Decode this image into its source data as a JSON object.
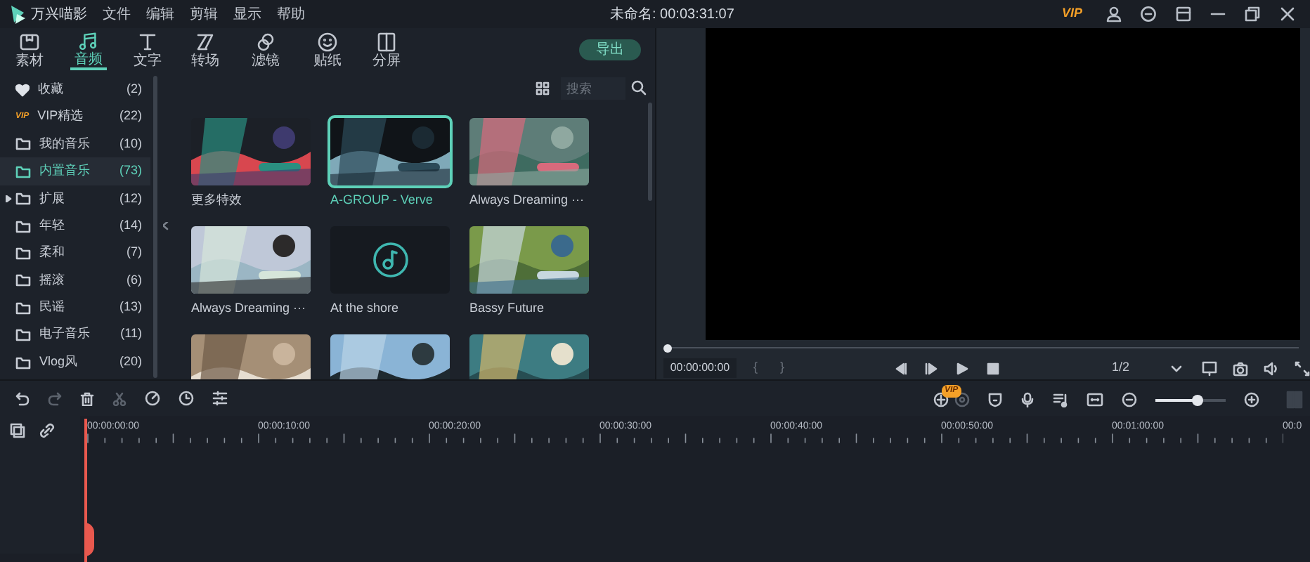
{
  "title_bar": {
    "app_name": "万兴喵影",
    "menu": [
      "文件",
      "编辑",
      "剪辑",
      "显示",
      "帮助"
    ],
    "project_title": "未命名: 00:03:31:07",
    "vip_badge": "VIP"
  },
  "media_tabs": [
    {
      "label": "素材",
      "selected": false
    },
    {
      "label": "音频",
      "selected": true
    },
    {
      "label": "文字",
      "selected": false
    },
    {
      "label": "转场",
      "selected": false
    },
    {
      "label": "滤镜",
      "selected": false
    },
    {
      "label": "贴纸",
      "selected": false
    },
    {
      "label": "分屏",
      "selected": false
    }
  ],
  "export_button": "导出",
  "library": [
    {
      "kind": "favorite",
      "label": "收藏",
      "count": "(2)",
      "selected": false
    },
    {
      "kind": "vip",
      "badge": "VIP",
      "label": "VIP精选",
      "count": "(22)",
      "selected": false
    },
    {
      "kind": "folder",
      "label": "我的音乐",
      "count": "(10)",
      "selected": false
    },
    {
      "kind": "folder",
      "label": "内置音乐",
      "count": "(73)",
      "selected": true
    },
    {
      "kind": "group",
      "label": "扩展",
      "count": "(12)",
      "selected": false,
      "expanded": false
    },
    {
      "kind": "folder",
      "label": "年轻",
      "count": "(14)",
      "selected": false
    },
    {
      "kind": "folder",
      "label": "柔和",
      "count": "(7)",
      "selected": false
    },
    {
      "kind": "folder",
      "label": "摇滚",
      "count": "(6)",
      "selected": false
    },
    {
      "kind": "folder",
      "label": "民谣",
      "count": "(13)",
      "selected": false
    },
    {
      "kind": "folder",
      "label": "电子音乐",
      "count": "(11)",
      "selected": false
    },
    {
      "kind": "folder",
      "label": "Vlog风",
      "count": "(20)",
      "selected": false
    }
  ],
  "search": {
    "placeholder": "搜索"
  },
  "media_items": [
    {
      "kind": "picture",
      "title": "更多特效",
      "selected": false
    },
    {
      "kind": "picture",
      "title": "A-GROUP - Verve",
      "selected": true
    },
    {
      "kind": "picture",
      "title": "Always Dreaming ···",
      "selected": false
    },
    {
      "kind": "picture",
      "title": "Always Dreaming ···",
      "selected": false
    },
    {
      "kind": "audio",
      "title": "At the shore",
      "selected": false
    },
    {
      "kind": "picture",
      "title": "Bassy Future",
      "selected": false
    },
    {
      "kind": "picture",
      "selected": false
    },
    {
      "kind": "picture",
      "selected": false
    },
    {
      "kind": "picture",
      "selected": false
    }
  ],
  "preview": {
    "progress": {
      "level": 0
    },
    "timecode": "00:00:00:00",
    "mark_in": "{",
    "mark_out": "}",
    "scale": "1/2"
  },
  "timeline": {
    "vip_badge": "VIP",
    "zoom": {
      "level": 0.6
    },
    "ruler": [
      "00:00:00:00",
      "00:00:10:00",
      "00:00:20:00",
      "00:00:30:00",
      "00:00:40:00",
      "00:00:50:00",
      "00:01:00:00",
      "00:0"
    ]
  }
}
